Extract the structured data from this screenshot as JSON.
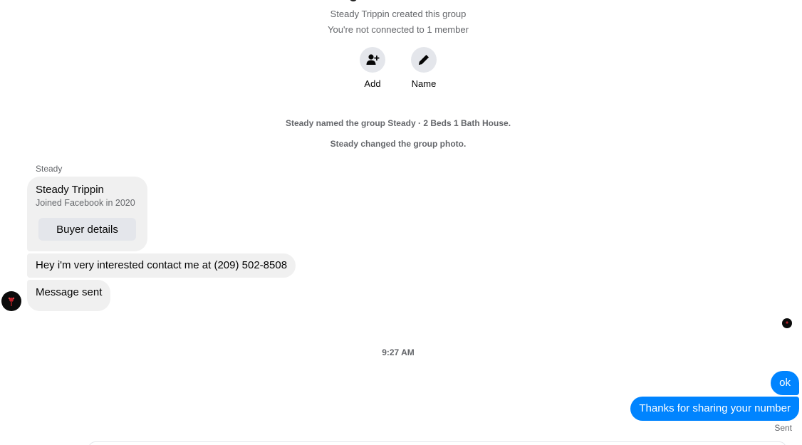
{
  "group_info": {
    "created_line": "Steady Trippin created this group",
    "connection_line": "You're not connected to 1 member"
  },
  "actions": [
    {
      "label": "Add",
      "icon": "add-person-icon"
    },
    {
      "label": "Name",
      "icon": "pencil-icon"
    }
  ],
  "events": [
    "Steady named the group Steady · 2 Beds 1 Bath House.",
    "Steady changed the group photo."
  ],
  "incoming": {
    "sender_name": "Steady",
    "card": {
      "name": "Steady Trippin",
      "subtitle": "Joined Facebook in 2020",
      "button_label": "Buyer details"
    },
    "messages": [
      "Hey i'm very interested contact me at (209) 502-8508",
      "Message sent"
    ]
  },
  "timestamp": "9:27 AM",
  "outgoing": {
    "messages": [
      "ok",
      "Thanks for sharing your number"
    ],
    "status": "Sent"
  },
  "colors": {
    "outgoing_bubble": "#0084ff",
    "incoming_bubble": "#f0f0f0",
    "secondary_text": "#65676b"
  }
}
